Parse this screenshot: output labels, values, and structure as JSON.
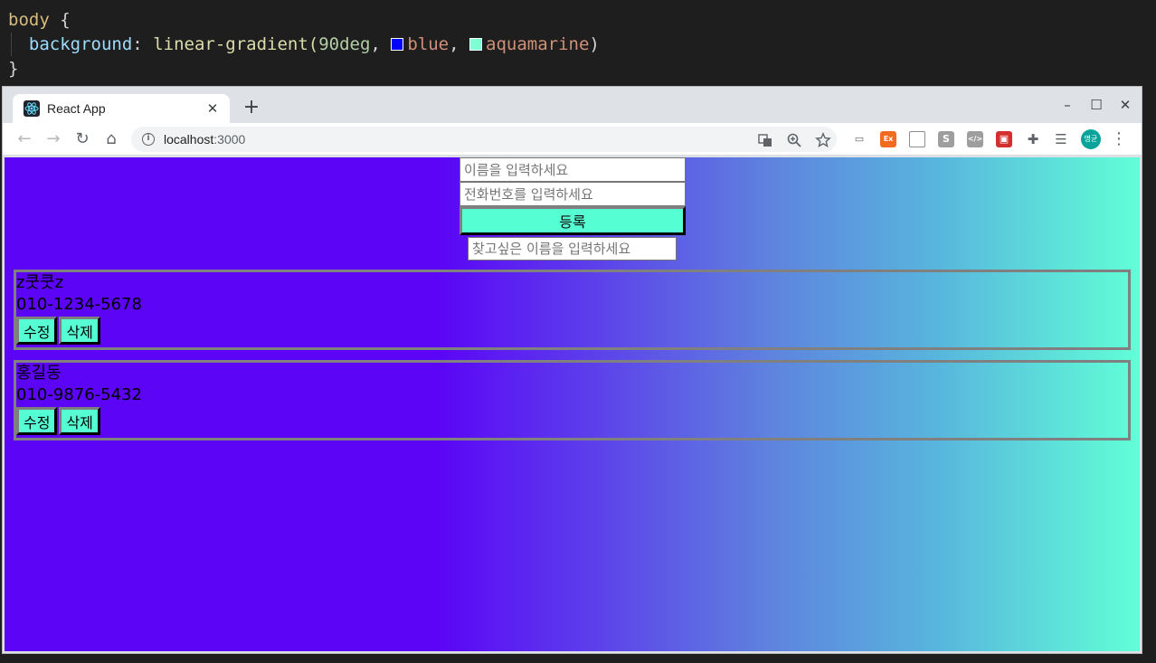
{
  "editor": {
    "line1": {
      "selector": "body",
      "brace": "{"
    },
    "line2": {
      "property": "background",
      "colon": ":",
      "fn": "linear-gradient(",
      "angle": "90deg",
      "comma1": ",",
      "color1": "blue",
      "comma2": ",",
      "color2": "aquamarine",
      "close": ")"
    },
    "line3": {
      "brace": "}"
    },
    "swatch_colors": [
      "#0000ff",
      "#7fffd4"
    ]
  },
  "browser": {
    "tab_title": "React App",
    "tab_close": "✕",
    "new_tab": "+",
    "window_controls": {
      "minimize": "–",
      "maximize": "☐",
      "close": "✕"
    },
    "nav": {
      "back": "←",
      "forward": "→",
      "reload": "↻",
      "home": "⌂"
    },
    "url_host": "localhost",
    "url_port": ":3000",
    "info_icon": "i",
    "omnibox_icons": [
      "translate-icon",
      "zoom-icon",
      "bookmark-star-icon"
    ],
    "extensions": {
      "screen": "▭",
      "ex": "Ex",
      "window": "",
      "s": "S",
      "code": "</>",
      "cam": "▣",
      "puzzle": "✚",
      "queue": "☰"
    },
    "avatar": "명균",
    "menu": "⋮"
  },
  "page": {
    "name_placeholder": "이름을 입력하세요",
    "phone_placeholder": "전화번호를 입력하세요",
    "submit_label": "등록",
    "search_placeholder": "찾고싶은 이름을 입력하세요",
    "contacts": [
      {
        "name": "z쿳쿳z",
        "phone": "010-1234-5678",
        "edit": "수정",
        "delete": "삭제"
      },
      {
        "name": "홍길동",
        "phone": "010-9876-5432",
        "edit": "수정",
        "delete": "삭제"
      }
    ]
  },
  "colors": {
    "gradient_start": "#5b04f6",
    "gradient_end": "#61ffd7",
    "button_bg": "#56ffd3",
    "avatar_bg": "#0aa39c"
  }
}
